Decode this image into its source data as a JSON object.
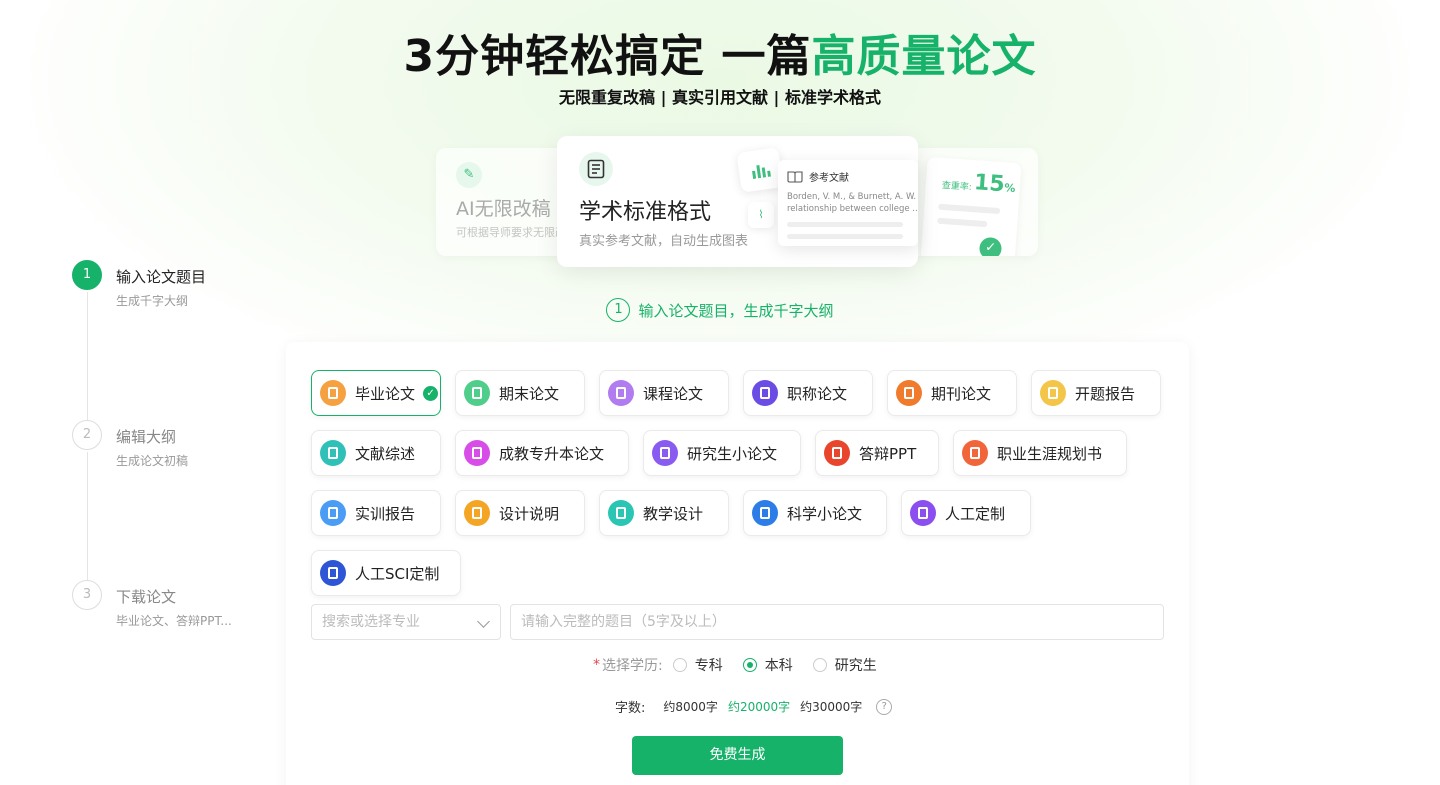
{
  "hero": {
    "title_main": "3分钟轻松搞定 一篇",
    "title_highlight": "高质量论文",
    "subtitle": "无限重复改稿 | 真实引用文献 | 标准学术格式"
  },
  "features": {
    "left": {
      "title": "AI无限改稿",
      "desc": "可根据导师要求无限改"
    },
    "main": {
      "title": "学术标准格式",
      "desc": "真实参考文献，自动生成图表"
    },
    "reference": {
      "header": "参考文献",
      "line1": "Borden, V. M., & Burnett, A. W.",
      "line2": "relationship between college ..."
    },
    "check": {
      "label": "查重率:",
      "value": "15",
      "unit": "%"
    }
  },
  "steps": [
    {
      "num": "1",
      "title": "输入论文题目",
      "sub": "生成千字大纲"
    },
    {
      "num": "2",
      "title": "编辑大纲",
      "sub": "生成论文初稿"
    },
    {
      "num": "3",
      "title": "下载论文",
      "sub": "毕业论文、答辩PPT..."
    }
  ],
  "step_label": {
    "num": "1",
    "text": "输入论文题目，生成千字大纲"
  },
  "types": [
    {
      "label": "毕业论文",
      "color": "#f5a142"
    },
    {
      "label": "期末论文",
      "color": "#4fce8b"
    },
    {
      "label": "课程论文",
      "color": "#b07cf0"
    },
    {
      "label": "职称论文",
      "color": "#6b4de6"
    },
    {
      "label": "期刊论文",
      "color": "#f07b2c"
    },
    {
      "label": "开题报告",
      "color": "#f3c64a"
    },
    {
      "label": "文献综述",
      "color": "#2fc1b8"
    },
    {
      "label": "成教专升本论文",
      "color": "#d84de8"
    },
    {
      "label": "研究生小论文",
      "color": "#8a5bf0"
    },
    {
      "label": "答辩PPT",
      "color": "#e8452c"
    },
    {
      "label": "职业生涯规划书",
      "color": "#f2653a"
    },
    {
      "label": "实训报告",
      "color": "#4b9cf5"
    },
    {
      "label": "设计说明",
      "color": "#f5a524"
    },
    {
      "label": "教学设计",
      "color": "#2bc6b3"
    },
    {
      "label": "科学小论文",
      "color": "#2c7de8"
    },
    {
      "label": "人工定制",
      "color": "#8b4ff0"
    },
    {
      "label": "人工SCI定制",
      "color": "#2d55d6"
    }
  ],
  "form": {
    "major_placeholder": "搜索或选择专业",
    "title_placeholder": "请输入完整的题目（5字及以上）",
    "edu_required": "*",
    "edu_label": "选择学历:",
    "edu_options": [
      "专科",
      "本科",
      "研究生"
    ],
    "edu_selected": "本科",
    "wc_label": "字数:",
    "wc_options": [
      "约8000字",
      "约20000字",
      "约30000字"
    ],
    "wc_selected": "约20000字",
    "help_icon": "?",
    "submit": "免费生成"
  },
  "colors": {
    "accent": "#17b26a"
  }
}
